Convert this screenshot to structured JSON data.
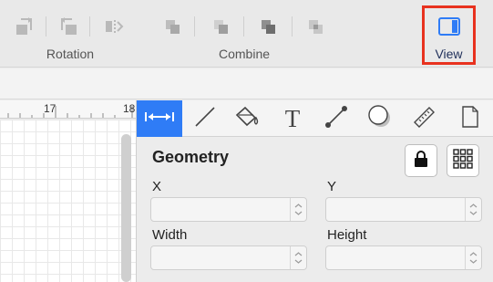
{
  "toolbar": {
    "groups": [
      {
        "label": "Rotation"
      },
      {
        "label": "Combine"
      }
    ],
    "view_label": "View"
  },
  "ruler": {
    "labels": [
      "17",
      "18"
    ]
  },
  "inspector": {
    "tabs": [
      {
        "icon": "geometry-icon",
        "active": true
      },
      {
        "icon": "line-icon"
      },
      {
        "icon": "fill-bucket-icon"
      },
      {
        "icon": "text-icon"
      },
      {
        "icon": "connection-icon"
      },
      {
        "icon": "shadow-icon"
      },
      {
        "icon": "ruler-icon"
      },
      {
        "icon": "document-icon"
      }
    ],
    "text_tab_glyph": "T",
    "section_title": "Geometry",
    "fields": {
      "x_label": "X",
      "y_label": "Y",
      "width_label": "Width",
      "height_label": "Height",
      "x_value": "",
      "y_value": "",
      "width_value": "",
      "height_value": ""
    }
  },
  "colors": {
    "accent": "#2f7cf6",
    "highlight_box": "#e8321f"
  }
}
